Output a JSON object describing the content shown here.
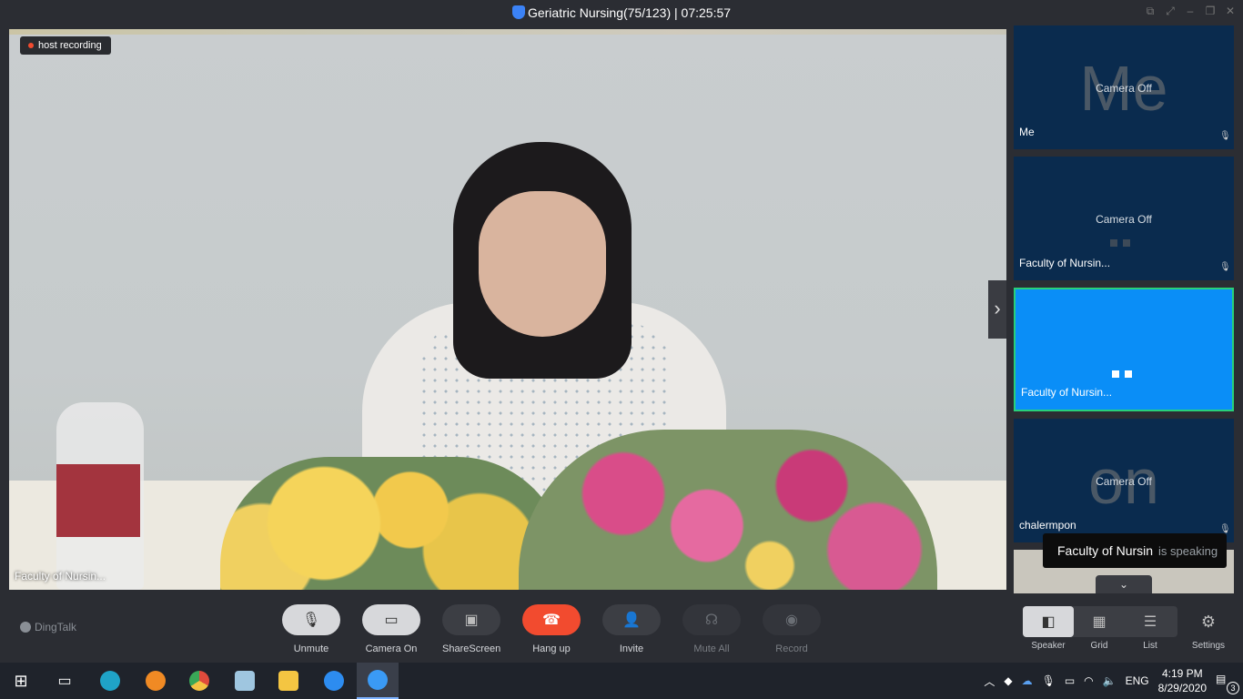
{
  "window": {
    "title": "Geriatric Nursing(75/123)",
    "separator": "|",
    "elapsed": "07:25:57"
  },
  "main_video": {
    "recording_label": "host recording",
    "participant_name": "Faculty of Nursin..."
  },
  "participants": [
    {
      "avatar_text": "Me",
      "status": "Camera Off",
      "name": "Me"
    },
    {
      "avatar_text": "",
      "status": "Camera Off",
      "name": "Faculty of Nursin..."
    },
    {
      "avatar_text": "",
      "status": "",
      "name": "Faculty of Nursin..."
    },
    {
      "avatar_text": "on",
      "status": "Camera Off",
      "name": "chalermpon"
    }
  ],
  "speaking": {
    "who": "Faculty of Nursin",
    "what": "is speaking"
  },
  "toolbar": {
    "brand": "DingTalk",
    "buttons": {
      "unmute": "Unmute",
      "camera": "Camera On",
      "share": "ShareScreen",
      "hangup": "Hang up",
      "invite": "Invite",
      "mute_all": "Mute All",
      "record": "Record"
    },
    "views": {
      "speaker": "Speaker",
      "grid": "Grid",
      "list": "List"
    },
    "settings": "Settings"
  },
  "taskbar": {
    "language": "ENG",
    "time": "4:19 PM",
    "date": "8/29/2020",
    "notifications": "3"
  },
  "colors": {
    "accent_blue": "#0a8ef7",
    "hangup_red": "#f24b2f",
    "tile_bg": "#0a2b4e",
    "speaking_border": "#28d07a"
  }
}
